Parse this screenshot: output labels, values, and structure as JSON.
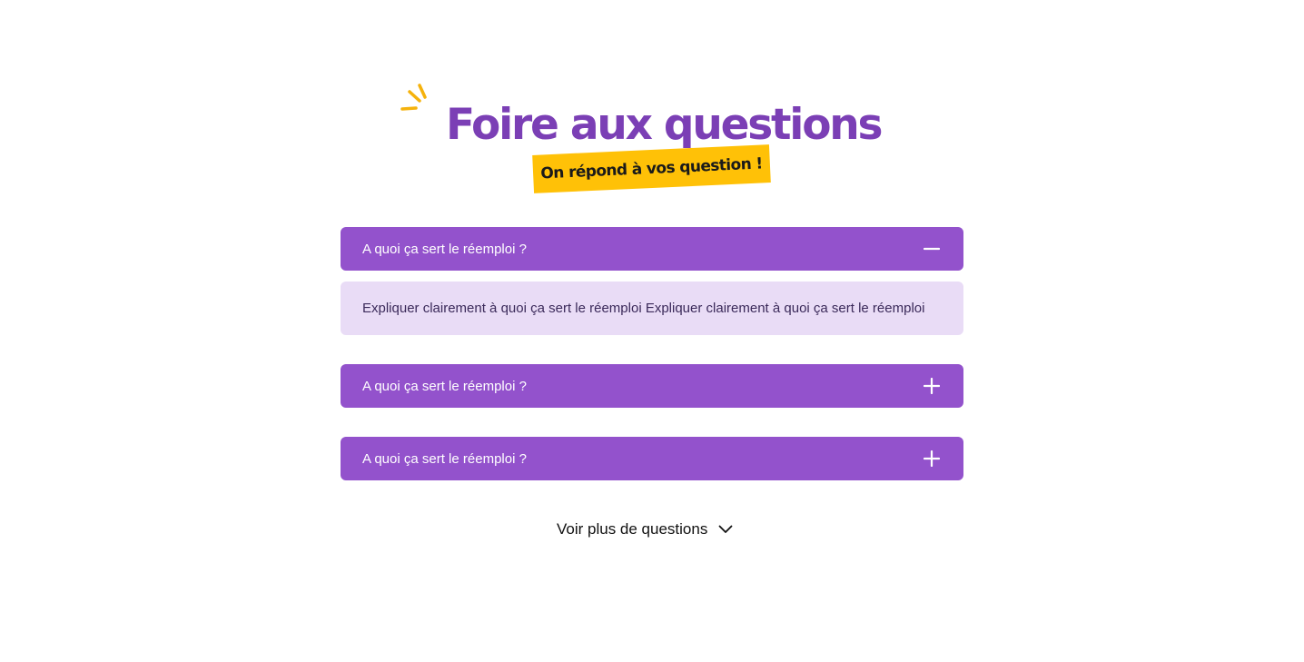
{
  "header": {
    "title": "Foire aux questions",
    "subtitle": "On répond à vos question !"
  },
  "faq": {
    "items": [
      {
        "question": "A quoi ça sert le réemploi ?",
        "expanded": true,
        "toggle_icon": "minus-icon",
        "answer": "Expliquer clairement à quoi ça sert le réemploi Expliquer clairement à quoi ça sert le réemploi"
      },
      {
        "question": "A quoi ça sert le réemploi ?",
        "expanded": false,
        "toggle_icon": "plus-icon"
      },
      {
        "question": "A quoi ça sert le réemploi ?",
        "expanded": false,
        "toggle_icon": "plus-icon"
      }
    ]
  },
  "see_more": {
    "label": "Voir plus de questions",
    "icon": "chevron-down-icon"
  },
  "colors": {
    "title": "#7b3fb5",
    "accordion_header": "#9352cc",
    "accordion_answer_bg": "#e9dcf6",
    "subtitle_tag": "#ffc107",
    "sparkle": "#f5b20c"
  }
}
